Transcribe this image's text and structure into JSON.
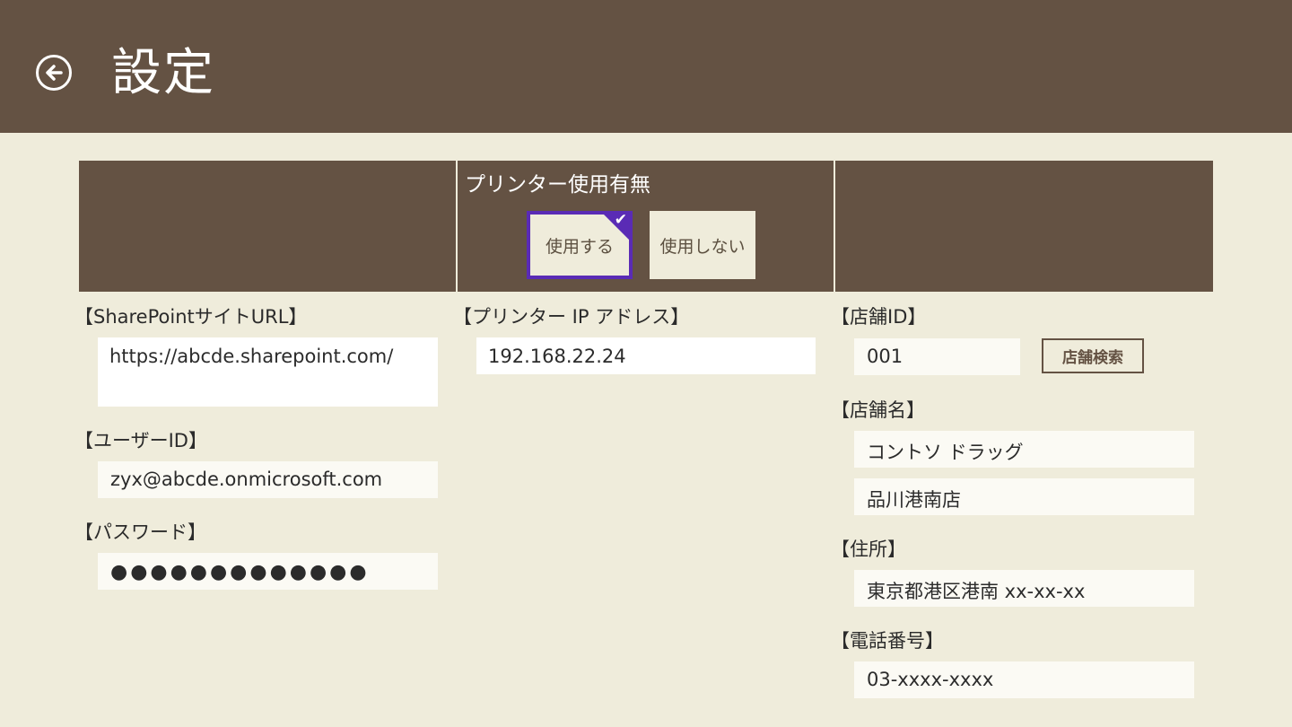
{
  "header": {
    "title": "設定",
    "back_icon": "arrow-left-circle-icon"
  },
  "sharepoint": {
    "url_label": "【SharePointサイトURL】",
    "url_value": "https://abcde.sharepoint.com/",
    "user_label": "【ユーザーID】",
    "user_value": "zyx@abcde.onmicrosoft.com",
    "password_label": "【パスワード】",
    "password_value": "●●●●●●●●●●●●●"
  },
  "printer": {
    "title": "プリンター使用有無",
    "use_label": "使用する",
    "no_use_label": "使用しない",
    "selected": "使用する",
    "ip_label": "【プリンター IP アドレス】",
    "ip_value": "192.168.22.24"
  },
  "store": {
    "id_label": "【店舗ID】",
    "id_value": "001",
    "search_button": "店舗検索",
    "name_label": "【店舗名】",
    "name_line1": "コントソ ドラッグ",
    "name_line2": "品川港南店",
    "address_label": "【住所】",
    "address_value": "東京都港区港南 xx-xx-xx",
    "phone_label": "【電話番号】",
    "phone_value": "03-xxxx-xxxx"
  },
  "colors": {
    "header_bg": "#645243",
    "page_bg": "#efecdb",
    "selected_accent": "#5a2bb5"
  }
}
